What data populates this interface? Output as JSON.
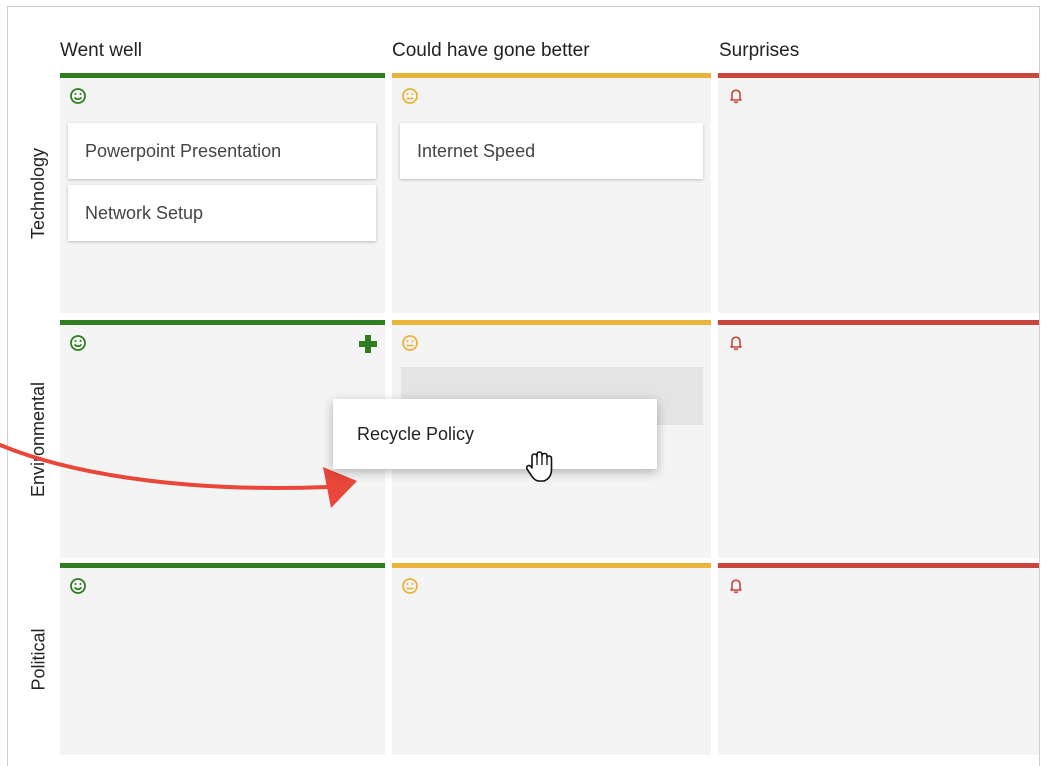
{
  "columns": [
    {
      "title": "Went well",
      "accent": "#2e7d1f",
      "icon": "smiley-icon"
    },
    {
      "title": "Could have gone better",
      "accent": "#e8b43a",
      "icon": "neutral-face-icon"
    },
    {
      "title": "Surprises",
      "accent": "#c9463d",
      "icon": "bell-icon"
    }
  ],
  "rows": [
    {
      "label": "Technology"
    },
    {
      "label": "Environmental"
    },
    {
      "label": "Political"
    }
  ],
  "cards": {
    "tech_went_well": [
      "Powerpoint Presentation",
      "Network Setup"
    ],
    "tech_better": [
      "Internet Speed"
    ]
  },
  "dragging": {
    "label": "Recycle Policy"
  },
  "icons": {
    "add": "plus-icon",
    "cursor": "grab-hand-cursor-icon",
    "arrow": "drag-arrow-icon"
  },
  "colors": {
    "green": "#2e7d1f",
    "yellow": "#e8b43a",
    "red": "#c9463d",
    "arrow": "#e8473a",
    "cell_bg": "#f4f4f4"
  }
}
